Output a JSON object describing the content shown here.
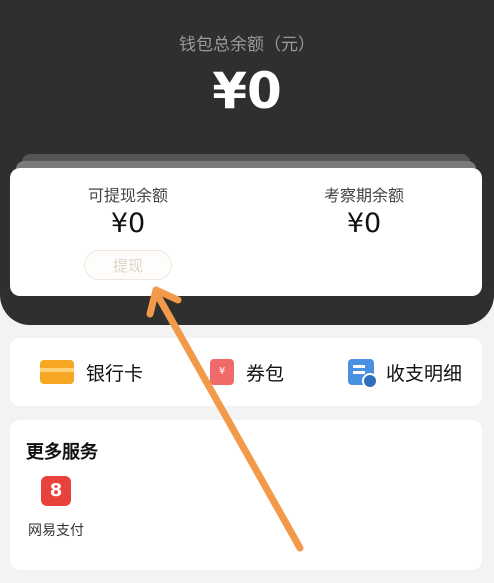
{
  "wallet": {
    "total_label": "钱包总余额（元）",
    "total_value": "¥0",
    "withdrawable_label": "可提现余额",
    "withdrawable_value": "¥0",
    "withdraw_button": "提现",
    "review_label": "考察期余额",
    "review_value": "¥0"
  },
  "shortcuts": {
    "bank_card": "银行卡",
    "coupons": "券包",
    "coupon_icon_text": "¥",
    "bills": "收支明细"
  },
  "services": {
    "title": "更多服务",
    "items": [
      {
        "label": "网易支付",
        "icon_text": "8"
      }
    ]
  },
  "colors": {
    "header_bg": "#2f2f2f",
    "annotation_arrow": "#f2994a"
  }
}
